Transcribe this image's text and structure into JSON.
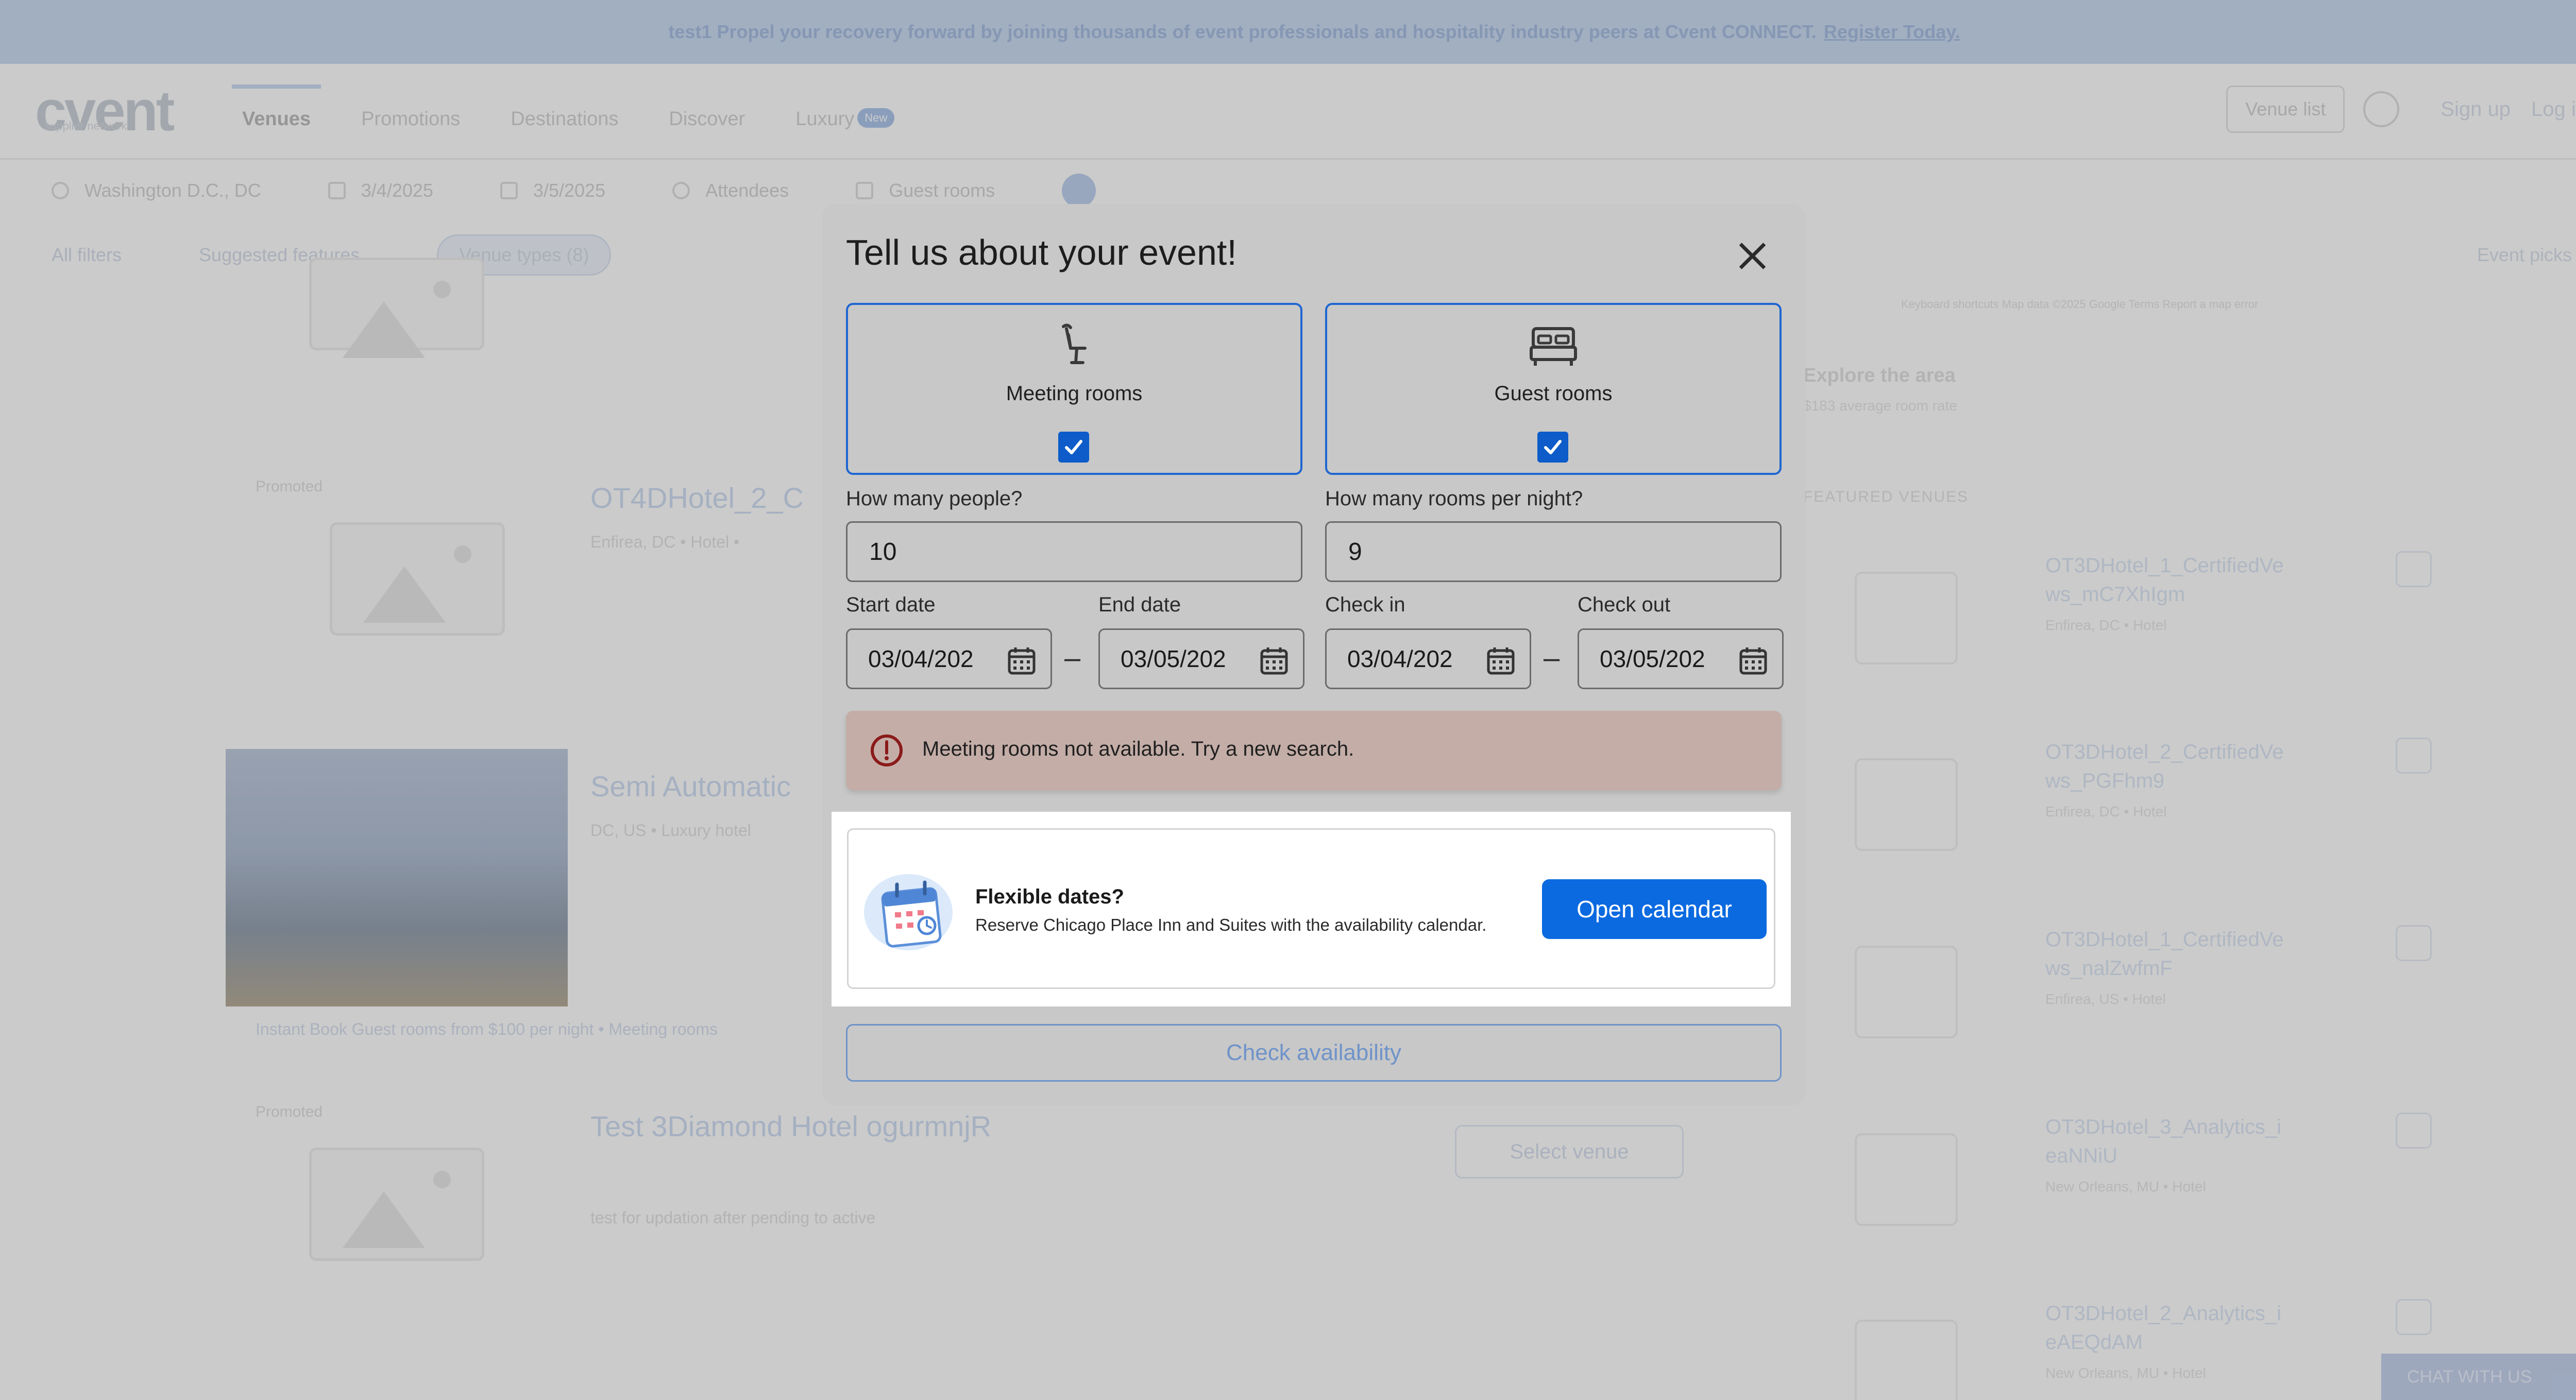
{
  "banner": {
    "text": "test1 Propel your recovery forward by joining thousands of event professionals and hospitality industry peers at Cvent CONNECT.",
    "link": "Register Today."
  },
  "header": {
    "logo": "cvent",
    "tabs": [
      "Venues",
      "Promotions",
      "Destinations",
      "Discover",
      "Luxury"
    ],
    "new_badge": "New",
    "venue_list": "Venue list",
    "sign_up": "Sign up",
    "log_in": "Log in"
  },
  "search": {
    "location": "Washington D.C., DC",
    "start": "3/4/2025",
    "end": "3/5/2025",
    "attendees": "Attendees",
    "guest_rooms": "Guest rooms"
  },
  "filters": {
    "all_filters": "All filters",
    "suggested": "Suggested features",
    "venue_types": "Venue types (8)",
    "event_picks": "Event picks"
  },
  "listings": {
    "promoted": "Promoted",
    "venue2_title": "OT4DHotel_2_C",
    "venue2_meta": "Enfirea, DC  •  Hotel  •",
    "venue3_title": "Semi Automatic",
    "venue3_meta": "DC, US  •  Luxury hotel",
    "instant_book": "Instant Book  Guest rooms from $100 per night  •  Meeting rooms",
    "venue4_title": "Test 3Diamond Hotel ogurmnjR",
    "venue4_desc": "test for updation after pending to active",
    "select_venue": "Select venue"
  },
  "sidebar": {
    "map_info": "Keyboard shortcuts   Map data ©2025 Google   Terms   Report a map error",
    "explore": "Explore the area",
    "explore_sub": "$183 average room rate",
    "featured": "FEATURED VENUES",
    "items": [
      {
        "title": "OT3DHotel_1_CertifiedVe ws_mC7XhIgm",
        "meta": "Enfirea, DC  •  Hotel"
      },
      {
        "title": "OT3DHotel_2_CertifiedVe ws_PGFhm9",
        "meta": "Enfirea, DC  •  Hotel"
      },
      {
        "title": "OT3DHotel_1_CertifiedVe ws_nalZwfmF",
        "meta": "Enfirea, US  •  Hotel"
      },
      {
        "title": "OT3DHotel_3_Analytics_i eaNNiU",
        "meta": "New Orleans, MU  •  Hotel"
      },
      {
        "title": "OT3DHotel_2_Analytics_i eAEQdAM",
        "meta": "New Orleans, MU  •  Hotel"
      }
    ],
    "chat": "CHAT WITH US"
  },
  "modal": {
    "title": "Tell us about your event!",
    "meeting_rooms": "Meeting rooms",
    "guest_rooms": "Guest rooms",
    "meeting_checked": true,
    "guest_checked": true,
    "people_label": "How many people?",
    "people_value": "10",
    "rooms_label": "How many rooms per night?",
    "rooms_value": "9",
    "start_label": "Start date",
    "start_value": "03/04/202",
    "end_label": "End date",
    "end_value": "03/05/202",
    "checkin_label": "Check in",
    "checkin_value": "03/04/202",
    "checkout_label": "Check out",
    "checkout_value": "03/05/202",
    "error": "Meeting rooms not available. Try a new search.",
    "flex_title": "Flexible dates?",
    "flex_sub": "Reserve Chicago Place Inn and Suites with the availability calendar.",
    "open_calendar": "Open calendar",
    "check_availability": "Check availability"
  },
  "colors": {
    "primary": "#0b6ae0",
    "checkbox": "#0d5cc9",
    "error_bg": "#c4ada7",
    "overlay": "rgba(70,70,70,0.28)"
  }
}
